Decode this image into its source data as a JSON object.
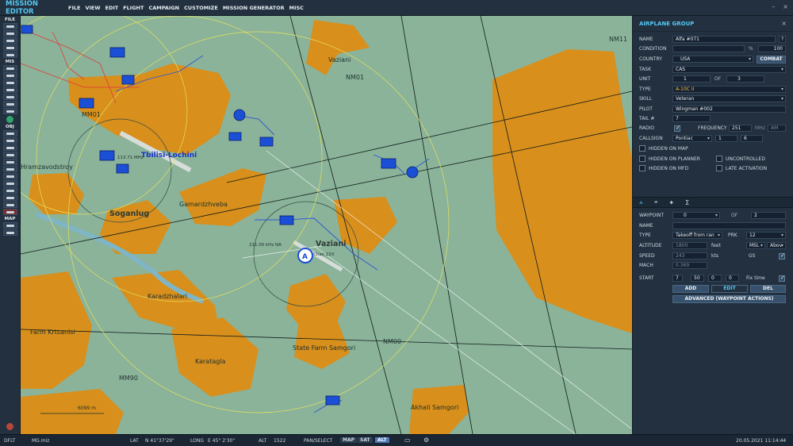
{
  "app": {
    "title": "MISSION EDITOR"
  },
  "menu": [
    "FILE",
    "VIEW",
    "EDIT",
    "FLIGHT",
    "CAMPAIGN",
    "CUSTOMIZE",
    "MISSION GENERATOR",
    "MISC"
  ],
  "toolbar": {
    "sections": [
      "FILE",
      "MIS",
      "OBJ",
      "MAP"
    ]
  },
  "map": {
    "towns": [
      {
        "name": "Vaziani"
      },
      {
        "name": "Soganlug"
      },
      {
        "name": "Gamardzhveba"
      },
      {
        "name": "Karadzhalari"
      },
      {
        "name": "Karatagla"
      },
      {
        "name": "State Farm Samgori"
      },
      {
        "name": "Akhali Samgori"
      },
      {
        "name": "Hramzavodstroy"
      },
      {
        "name": "Farm Krtsanisi"
      }
    ],
    "navpoints": [
      "NM11",
      "NM01",
      "NM00",
      "MM90",
      "MM01"
    ],
    "airfields": [
      "Tbilisi-Lochini",
      "Vaziani"
    ],
    "ndb_labels": [
      "211.00 kHz NA",
      "113.71 MHz",
      "Chan 22X"
    ],
    "scale_label": "6099 m"
  },
  "panel": {
    "title": "AIRPLANE GROUP",
    "labels": {
      "name": "NAME",
      "condition": "CONDITION",
      "country": "COUNTRY",
      "task": "TASK",
      "unit": "UNIT",
      "of": "OF",
      "type": "TYPE",
      "skill": "SKILL",
      "pilot": "PILOT",
      "tail": "TAIL #",
      "radio": "RADIO",
      "frequency": "FREQUENCY",
      "callsign": "CALLSIGN"
    },
    "values": {
      "name": "Alfa #071",
      "condition_pct": "%",
      "condition_val": "100",
      "country": "USA",
      "country_btn": "COMBAT",
      "task": "CAS",
      "unit": "1",
      "unit_of": "3",
      "type": "A-10C II",
      "skill": "Veteran",
      "pilot": "Wingman #002",
      "tail": "7",
      "frequency": "251",
      "freq_unit": "MHz",
      "am": "AM",
      "callsign_name": "Pontiac",
      "callsign_a": "1",
      "callsign_b": "6"
    },
    "options": [
      {
        "label": "HIDDEN ON MAP",
        "checked": false
      },
      {
        "label": "HIDDEN ON PLANNER",
        "checked": false
      },
      {
        "label": "UNCONTROLLED",
        "checked": false
      },
      {
        "label": "HIDDEN ON MFD",
        "checked": false
      },
      {
        "label": "LATE ACTIVATION",
        "checked": false
      }
    ],
    "waypoint": {
      "labels": {
        "waypoint": "WAYPOINT",
        "of": "OF",
        "name": "NAME",
        "type": "TYPE",
        "prk": "PRK",
        "altitude": "ALTITUDE",
        "speed": "SPEED",
        "mach": "MACH",
        "start": "START",
        "feet": "feet",
        "kts": "kts",
        "gs": "GS",
        "fixtime": "Fix time"
      },
      "values": {
        "waypoint": "0",
        "of": "2",
        "type": "Takeoff from ran",
        "prk": "12",
        "altitude": "1800",
        "alt_ref": "MSL",
        "alt_ref2": "Abov",
        "speed": "243",
        "mach": "0.369",
        "start_d": "7",
        "start_h": "50",
        "start_m": "0",
        "start_s": "0"
      },
      "buttons": {
        "add": "ADD",
        "edit": "EDIT",
        "del": "DEL",
        "advanced": "ADVANCED (WAYPOINT ACTIONS)"
      }
    }
  },
  "status": {
    "profile": "DFLT",
    "file": "MG.miz",
    "lat_label": "LAT",
    "lat": "N 41°37'29\"",
    "long_label": "LONG",
    "long": "E 45° 2'30\"",
    "alt_label": "ALT",
    "alt": "1522",
    "mode": "PAN/SELECT",
    "map_btn": "MAP",
    "sat_btn": "SAT",
    "alt_btn": "ALT",
    "datetime": "20.05.2021 11:14:44"
  },
  "colors": {
    "accent": "#56c8f2",
    "urban": "#d88f1c",
    "terrain": "#8ab39a",
    "unit_blue": "#1a4fd6"
  }
}
